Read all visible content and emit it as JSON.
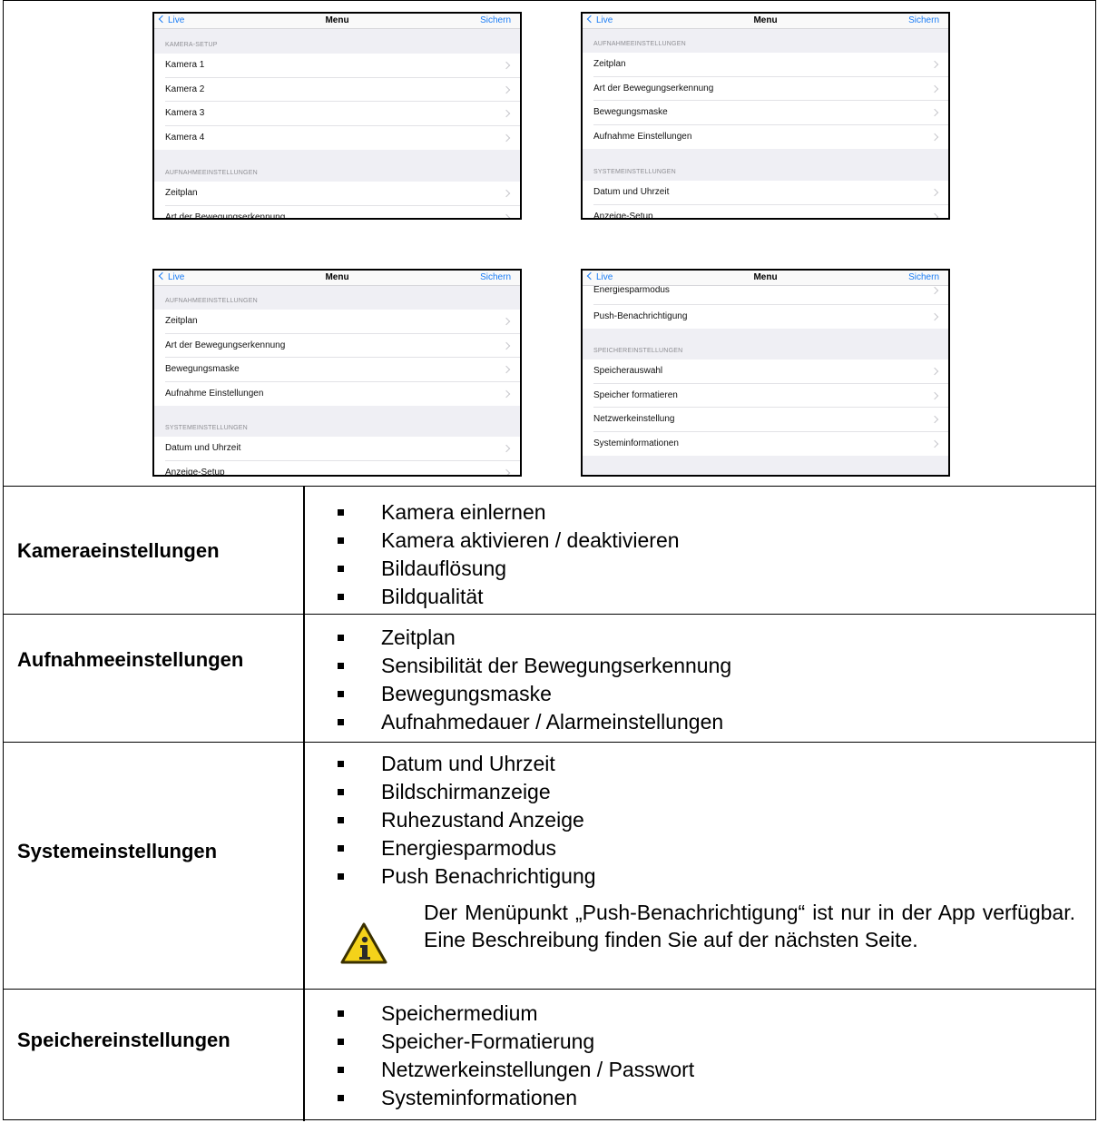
{
  "screens": [
    {
      "nav": {
        "back": "Live",
        "title": "Menu",
        "save": "Sichern"
      },
      "items": [
        {
          "kind": "section",
          "text": "KAMERA-SETUP"
        },
        {
          "kind": "row",
          "text": "Kamera 1"
        },
        {
          "kind": "row",
          "text": "Kamera 2"
        },
        {
          "kind": "row",
          "text": "Kamera 3"
        },
        {
          "kind": "row",
          "text": "Kamera 4"
        },
        {
          "kind": "section",
          "text": "AUFNAHMEEINSTELLUNGEN"
        },
        {
          "kind": "row",
          "text": "Zeitplan"
        },
        {
          "kind": "row",
          "text": "Art der Bewegungserkennung"
        }
      ]
    },
    {
      "nav": {
        "back": "Live",
        "title": "Menu",
        "save": "Sichern"
      },
      "items": [
        {
          "kind": "section",
          "text": "AUFNAHMEEINSTELLUNGEN"
        },
        {
          "kind": "row",
          "text": "Zeitplan"
        },
        {
          "kind": "row",
          "text": "Art der Bewegungserkennung"
        },
        {
          "kind": "row",
          "text": "Bewegungsmaske"
        },
        {
          "kind": "row",
          "text": "Aufnahme Einstellungen"
        },
        {
          "kind": "section",
          "text": "SYSTEMEINSTELLUNGEN"
        },
        {
          "kind": "row",
          "text": "Datum und Uhrzeit"
        },
        {
          "kind": "row",
          "text": "Anzeige-Setup"
        }
      ]
    },
    {
      "nav": {
        "back": "Live",
        "title": "Menu",
        "save": "Sichern"
      },
      "items": [
        {
          "kind": "section",
          "text": "AUFNAHMEEINSTELLUNGEN"
        },
        {
          "kind": "row",
          "text": "Zeitplan"
        },
        {
          "kind": "row",
          "text": "Art der Bewegungserkennung"
        },
        {
          "kind": "row",
          "text": "Bewegungsmaske"
        },
        {
          "kind": "row",
          "text": "Aufnahme Einstellungen"
        },
        {
          "kind": "section",
          "text": "SYSTEMEINSTELLUNGEN"
        },
        {
          "kind": "row",
          "text": "Datum und Uhrzeit"
        },
        {
          "kind": "row",
          "text": "Anzeige-Setup"
        }
      ]
    },
    {
      "nav": {
        "back": "Live",
        "title": "Menu",
        "save": "Sichern"
      },
      "items": [
        {
          "kind": "row",
          "text": "Energiesparmodus"
        },
        {
          "kind": "row",
          "text": "Push-Benachrichtigung"
        },
        {
          "kind": "section",
          "text": "SPEICHEREINSTELLUNGEN"
        },
        {
          "kind": "row",
          "text": "Speicherauswahl"
        },
        {
          "kind": "row",
          "text": "Speicher formatieren"
        },
        {
          "kind": "row",
          "text": "Netzwerkeinstellung"
        },
        {
          "kind": "row",
          "text": "Systeminformationen"
        }
      ]
    }
  ],
  "table": [
    {
      "category": "Kameraeinstellungen",
      "items": [
        "Kamera einlernen",
        "Kamera aktivieren / deaktivieren",
        "Bildauflösung",
        "Bildqualität"
      ]
    },
    {
      "category": "Aufnahmeeinstellungen",
      "items": [
        "Zeitplan",
        "Sensibilität der Bewegungserkennung",
        "Bewegungsmaske",
        "Aufnahmedauer / Alarmeinstellungen"
      ]
    },
    {
      "category": "Systemeinstellungen",
      "items": [
        "Datum und Uhrzeit",
        "Bildschirmanzeige",
        "Ruhezustand Anzeige",
        "Energiesparmodus",
        "Push Benachrichtigung"
      ],
      "note": {
        "icon": "info-warning-icon",
        "text": "Der Menüpunkt „Push-Benachrichtigung“ ist nur in der App verfügbar. Eine Beschreibung finden Sie auf der nächsten Seite."
      }
    },
    {
      "category": "Speichereinstellungen",
      "items": [
        "Speichermedium",
        "Speicher-Formatierung",
        "Netzwerkeinstellungen / Passwort",
        "Systeminformationen"
      ]
    }
  ],
  "colors": {
    "link": "#1a7cf5",
    "background": "#efeff4"
  }
}
